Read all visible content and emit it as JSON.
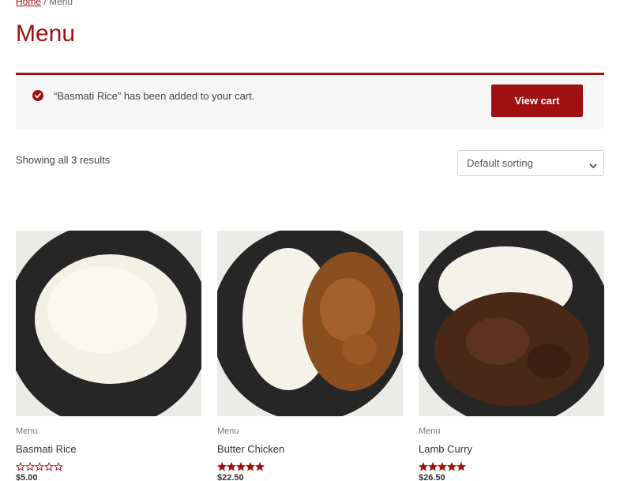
{
  "breadcrumb": {
    "home": "Home",
    "separator": "/",
    "current": "Menu"
  },
  "page_title": "Menu",
  "notice": {
    "message": "“Basmati Rice” has been added to your cart.",
    "button": "View cart",
    "icon": "check-circle-icon"
  },
  "results": {
    "count_text": "Showing all 3 results",
    "sort_selected": "Default sorting"
  },
  "colors": {
    "accent": "#a01010",
    "notice_bg": "#f7f6f7"
  },
  "products": [
    {
      "category": "Menu",
      "name": "Basmati Rice",
      "rating": 0,
      "price": "$5.00"
    },
    {
      "category": "Menu",
      "name": "Butter Chicken",
      "rating": 5,
      "price": "$22.50"
    },
    {
      "category": "Menu",
      "name": "Lamb Curry",
      "rating": 5,
      "price": "$26.50"
    }
  ]
}
